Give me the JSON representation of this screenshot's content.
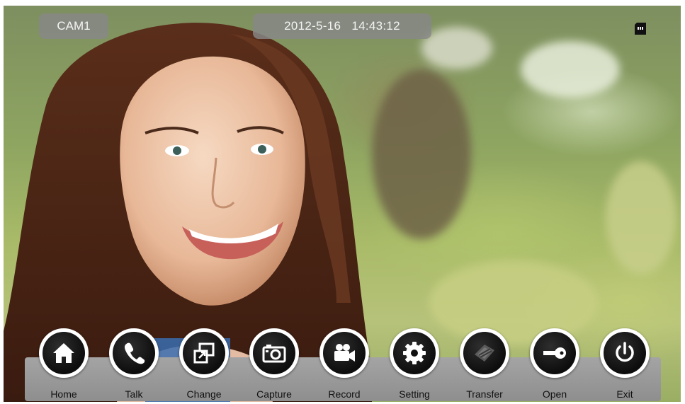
{
  "overlay": {
    "camera_label": "CAM1",
    "date": "2012-5-16",
    "time": "14:43:12"
  },
  "status": {
    "storage_icon": "sd-card-icon"
  },
  "toolbar": {
    "buttons": [
      {
        "label": "Home",
        "icon": "home-icon"
      },
      {
        "label": "Talk",
        "icon": "phone-icon"
      },
      {
        "label": "Change",
        "icon": "switch-window-icon"
      },
      {
        "label": "Capture",
        "icon": "camera-icon"
      },
      {
        "label": "Record",
        "icon": "video-camera-icon"
      },
      {
        "label": "Setting",
        "icon": "gear-icon"
      },
      {
        "label": "Transfer",
        "icon": "transfer-icon"
      },
      {
        "label": "Open",
        "icon": "key-icon"
      },
      {
        "label": "Exit",
        "icon": "power-icon"
      }
    ]
  },
  "colors": {
    "toolbar": "#9a9a9a",
    "overlay_pill": "#878787",
    "button_face": "#111111",
    "button_ring": "#ffffff"
  }
}
